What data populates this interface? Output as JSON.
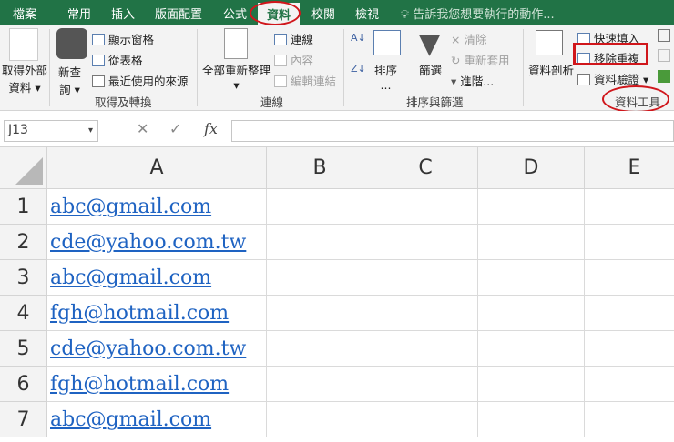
{
  "tabs": [
    "檔案",
    "常用",
    "插入",
    "版面配置",
    "公式",
    "資料",
    "校閱",
    "檢視"
  ],
  "tell_me": "告訴我您想要執行的動作...",
  "ribbon": {
    "get_external": "取得外部",
    "get_external2": "資料",
    "new_query": "新查",
    "new_query2": "詢",
    "show_queries": "顯示窗格",
    "from_table": "從表格",
    "recent_sources": "最近使用的來源",
    "group_get": "取得及轉換",
    "refresh_all": "全部重新整理",
    "connections": "連線",
    "properties": "內容",
    "edit_links": "編輯連結",
    "group_conn": "連線",
    "sort": "排序",
    "sort_more": "...",
    "filter": "篩選",
    "clear": "清除",
    "reapply": "重新套用",
    "advanced": "進階...",
    "group_sort": "排序與篩選",
    "text_to_cols": "資料剖析",
    "flash_fill": "快速填入",
    "remove_dup": "移除重複",
    "validation": "資料驗證",
    "group_tools": "資料工具"
  },
  "formula_bar": {
    "name_box": "J13",
    "cancel": "✕",
    "enter": "✓",
    "fx": "fx",
    "value": ""
  },
  "columns": [
    "A",
    "B",
    "C",
    "D",
    "E"
  ],
  "rows": [
    {
      "n": "1",
      "a": "abc@gmail.com"
    },
    {
      "n": "2",
      "a": "cde@yahoo.com.tw"
    },
    {
      "n": "3",
      "a": "abc@gmail.com"
    },
    {
      "n": "4",
      "a": "fgh@hotmail.com"
    },
    {
      "n": "5",
      "a": "cde@yahoo.com.tw"
    },
    {
      "n": "6",
      "a": "fgh@hotmail.com"
    },
    {
      "n": "7",
      "a": "abc@gmail.com"
    }
  ],
  "colors": {
    "brand": "#217346",
    "highlight": "#d0161b",
    "link": "#1f63c2"
  }
}
